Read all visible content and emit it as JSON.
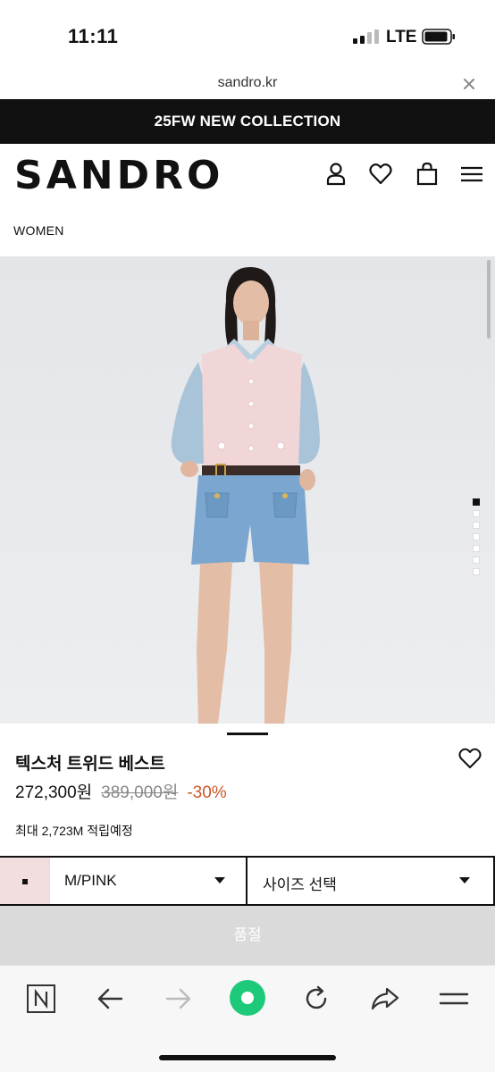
{
  "status_bar": {
    "time": "11:11",
    "network": "LTE"
  },
  "browser": {
    "url": "sandro.kr"
  },
  "banner": {
    "text": "25FW NEW COLLECTION"
  },
  "header": {
    "logo": "SANDRO"
  },
  "breadcrumb": "WOMEN",
  "gallery": {
    "slide_count": 7,
    "active_index": 0
  },
  "product": {
    "name": "텍스처 트위드 베스트",
    "sale_price": "272,300원",
    "original_price": "389,000원",
    "discount": "-30%",
    "points": "최대 2,723M 적립예정"
  },
  "selectors": {
    "color_value": "M/PINK",
    "swatch_color": "#f2dede",
    "size_placeholder": "사이즈 선택"
  },
  "soldout_label": "품절",
  "colors": {
    "accent_discount": "#c9582b",
    "banner_bg": "#111111"
  }
}
